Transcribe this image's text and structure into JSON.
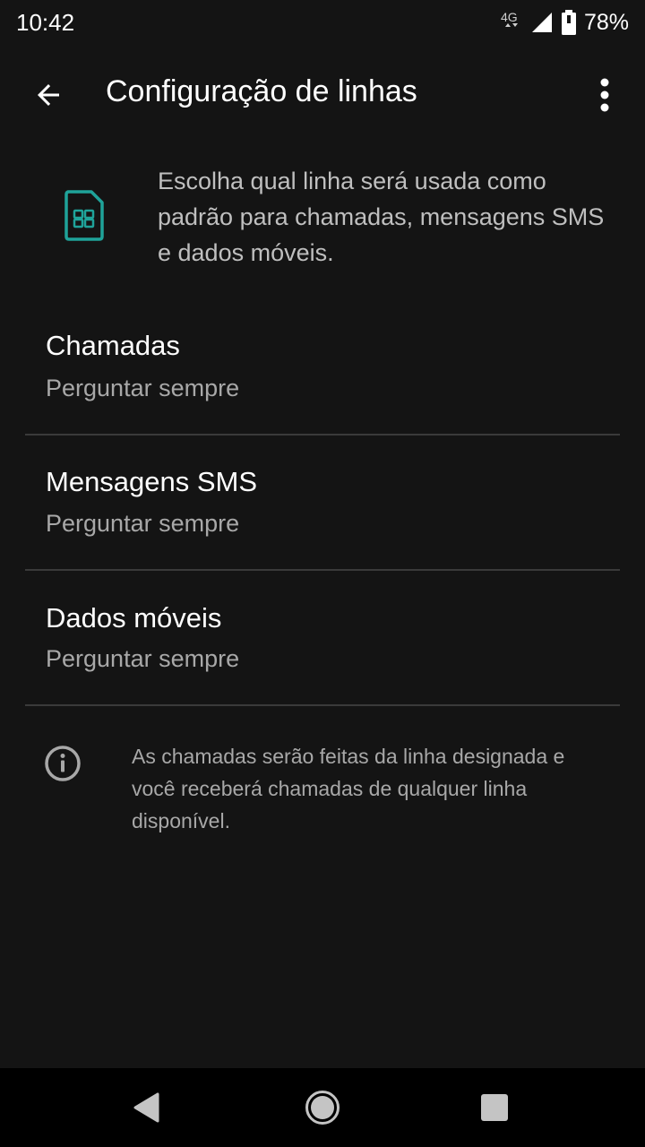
{
  "status_bar": {
    "time": "10:42",
    "network": "4G",
    "battery_pct": "78%",
    "signal-icon": "cell-signal-icon",
    "battery-icon": "battery-icon"
  },
  "app_bar": {
    "title": "Configuração de linhas",
    "back_icon": "arrow-back-icon",
    "overflow_icon": "more-vert-icon"
  },
  "intro": {
    "icon": "sim-card-icon",
    "text": "Escolha qual linha será usada como padrão para chamadas, mensagens SMS e dados móveis.",
    "icon_color": "#1fa39a"
  },
  "preferences": [
    {
      "title": "Chamadas",
      "summary": "Perguntar sempre"
    },
    {
      "title": "Mensagens SMS",
      "summary": "Perguntar sempre"
    },
    {
      "title": "Dados móveis",
      "summary": "Perguntar sempre"
    }
  ],
  "info": {
    "icon": "info-icon",
    "text": "As chamadas serão feitas da linha designada e você receberá chamadas de qualquer linha disponível."
  },
  "nav_bar": {
    "back_icon": "nav-back-icon",
    "home_icon": "nav-home-icon",
    "recents_icon": "nav-recents-icon"
  },
  "colors": {
    "background": "#141414",
    "accent": "#1fa39a",
    "divider": "#3a3a3a"
  }
}
